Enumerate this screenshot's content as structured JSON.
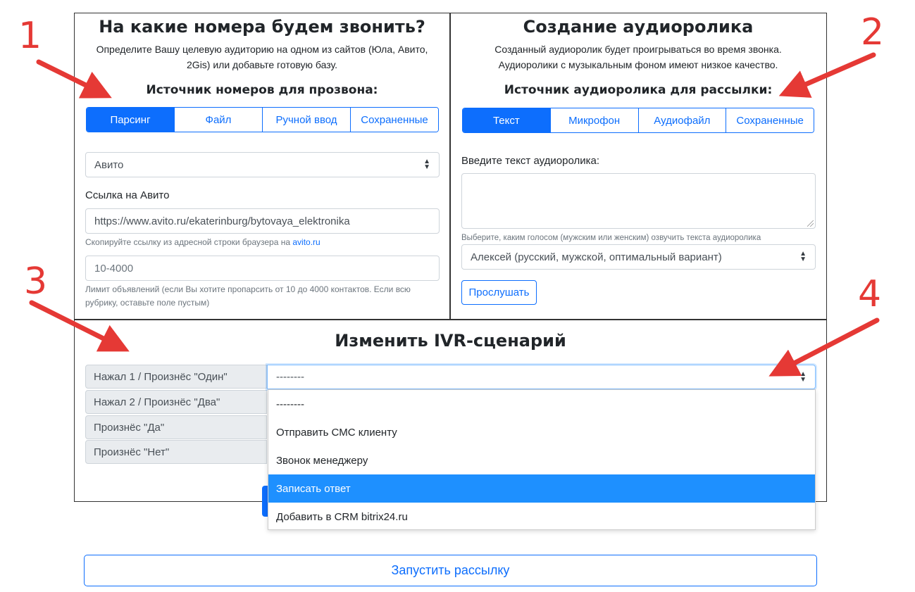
{
  "left_panel": {
    "title": "На какие номера будем звонить?",
    "description_line1": "Определите Вашу целевую аудиторию на одном из сайтов (Юла, Авито,",
    "description_line2": "2Gis) или добавьте готовую базу.",
    "source_heading": "Источник номеров для прозвона:",
    "tabs": [
      "Парсинг",
      "Файл",
      "Ручной ввод",
      "Сохраненные"
    ],
    "active_tab": "Парсинг",
    "site_select_value": "Авито",
    "link_label": "Ссылка на Авито",
    "link_value": "https://www.avito.ru/ekaterinburg/bytovaya_elektronika",
    "link_help_text": "Скопируйте ссылку из адресной строки браузера на",
    "link_help_link": "avito.ru",
    "limit_placeholder": "10-4000",
    "limit_help_line1": "Лимит объявлений (если Вы хотите пропарсить от 10 до 4000 контактов. Если всю",
    "limit_help_line2": "рубрику, оставьте поле пустым)"
  },
  "right_panel": {
    "title": "Создание аудиоролика",
    "description_line1": "Созданный аудиоролик будет проигрываться во время звонка.",
    "description_line2": "Аудиоролики с музыкальным фоном имеют низкое качество.",
    "source_heading": "Источник аудиоролика для рассылки:",
    "tabs": [
      "Текст",
      "Микрофон",
      "Аудиофайл",
      "Сохраненные"
    ],
    "active_tab": "Текст",
    "text_label": "Введите текст аудиоролика:",
    "text_value": "",
    "voice_help": "Выберите, каким голосом (мужским или женским) озвучить текста аудиоролика",
    "voice_value": "Алексей (русский, мужской, оптимальный вариант)",
    "listen_button": "Прослушать"
  },
  "ivr": {
    "title": "Изменить IVR-сценарий",
    "rows": [
      {
        "label": "Нажал 1 / Произнёс \"Один\"",
        "value": "--------"
      },
      {
        "label": "Нажал 2 / Произнёс \"Два\""
      },
      {
        "label": "Произнёс \"Да\""
      },
      {
        "label": "Произнёс \"Нет\""
      }
    ],
    "dropdown_options": [
      "--------",
      "Отправить СМС клиенту",
      "Звонок менеджеру",
      "Записать ответ",
      "Добавить в CRM bitrix24.ru"
    ],
    "highlighted_option": "Записать ответ"
  },
  "launch_button": "Запустить рассылку",
  "annotations": {
    "numbers": [
      "1",
      "2",
      "3",
      "4"
    ],
    "color": "#e53935"
  },
  "colors": {
    "primary": "#0d6efd",
    "dropdown_highlight": "#1e90ff"
  }
}
